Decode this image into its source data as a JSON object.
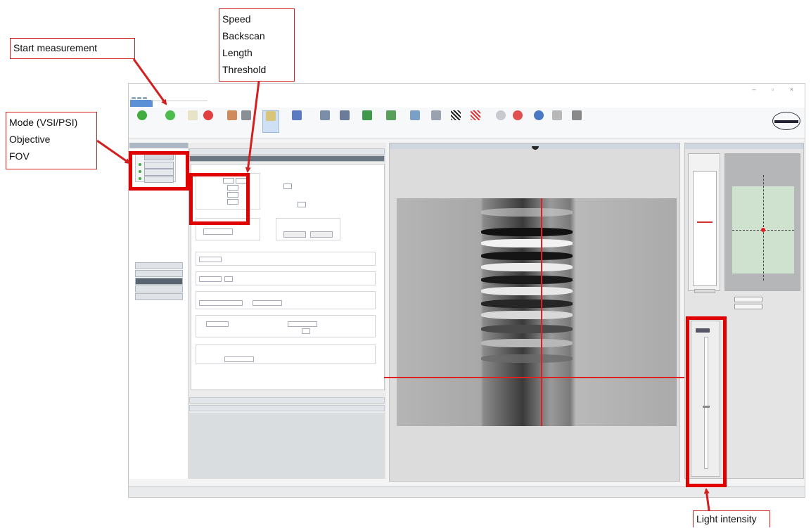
{
  "annotations": {
    "start_measurement": "Start measurement",
    "speed_group": [
      "Speed",
      "Backscan",
      "Length",
      "Threshold"
    ],
    "mode_group": [
      "Mode (VSI/PSI)",
      "Objective",
      "FOV"
    ],
    "light_intensity": "Light intensity"
  },
  "colors": {
    "annotation_red": "#e00000",
    "crosshair_red": "#e02020",
    "ribbon_active_tab": "#5b8fd6"
  },
  "icons": {
    "ribbon": [
      "green-start-icon",
      "green-measure-icon",
      "stop-icon",
      "record-icon",
      "camera-icon",
      "settings-icon",
      "grid-icon",
      "table-icon",
      "chart-icon",
      "pattern-icon",
      "help-icon",
      "print-icon"
    ]
  }
}
